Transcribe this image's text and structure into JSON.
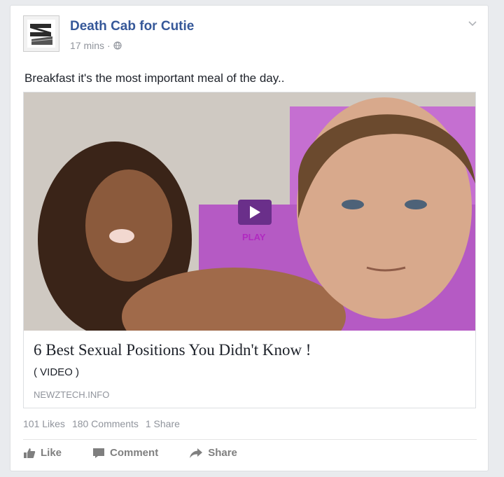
{
  "post": {
    "page_name": "Death Cab for Cutie",
    "time": "17 mins",
    "separator": "·",
    "privacy_icon": "globe-icon",
    "text": "Breakfast it's the most important meal of the day.."
  },
  "attachment": {
    "play_label": "PLAY",
    "title": "6 Best Sexual Positions You Didn't Know !",
    "description": "( VIDEO )",
    "domain": "NEWZTECH.INFO"
  },
  "stats": {
    "likes": "101 Likes",
    "comments": "180 Comments",
    "shares": "1 Share"
  },
  "actions": {
    "like": "Like",
    "comment": "Comment",
    "share": "Share"
  },
  "colors": {
    "link_blue": "#365899",
    "muted": "#90949c",
    "play_purple": "#6a2f8a"
  }
}
